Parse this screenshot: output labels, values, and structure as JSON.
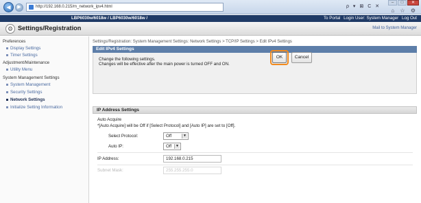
{
  "browser": {
    "url": "http://192.168.0.215/m_network_ipv4.html",
    "tools": "ρ ▾ ⊠ C ✕",
    "win_min": "–",
    "win_max": "□",
    "win_close": "✕",
    "fav": "⌂ ☆ ⚙"
  },
  "header": {
    "device": "LBP6030w/6018w / LBP6030w/6018w /",
    "links": [
      "To Portal",
      "Login User: System Manager",
      "Log Out"
    ]
  },
  "title_bar": {
    "title": "Settings/Registration",
    "mail_link": "Mail to System Manager"
  },
  "sidebar": {
    "groups": [
      {
        "label": "Preferences",
        "items": [
          {
            "label": "Display Settings"
          },
          {
            "label": "Timer Settings"
          }
        ]
      },
      {
        "label": "Adjustment/Maintenance",
        "items": [
          {
            "label": "Utility Menu"
          }
        ]
      },
      {
        "label": "System Management Settings",
        "items": [
          {
            "label": "System Management"
          },
          {
            "label": "Security Settings"
          },
          {
            "label": "Network Settings",
            "active": true
          },
          {
            "label": "Initialize Setting Information"
          }
        ]
      }
    ]
  },
  "main": {
    "breadcrumb": "Settings/Registration: System Management Settings: Network Settings > TCP/IP Settings > Edit IPv4 Settings",
    "panel_title": "Edit IPv4 Settings",
    "instruction_1": "Change the following settings.",
    "instruction_2": "Changes will be effective after the main power is turned OFF and ON.",
    "ok_label": "OK",
    "cancel_label": "Cancel",
    "section_title": "IP Address Settings",
    "auto_acquire_label": "Auto Acquire",
    "note": "*[Auto Acquire] will be Off if [Select Protocol] and [Auto IP] are set to [Off].",
    "select_protocol_label": "Select Protocol:",
    "select_protocol_value": "Off",
    "auto_ip_label": "Auto IP:",
    "auto_ip_value": "Off",
    "ip_address_label": "IP Address:",
    "ip_address_value": "192.168.0.215",
    "subnet_label": "Subnet Mask:",
    "subnet_value": "255.255.255.0"
  },
  "colors": {
    "header_bg": "#1f3a66",
    "panel_header_bg": "#5d7ea9",
    "highlight": "#f28a1d"
  }
}
